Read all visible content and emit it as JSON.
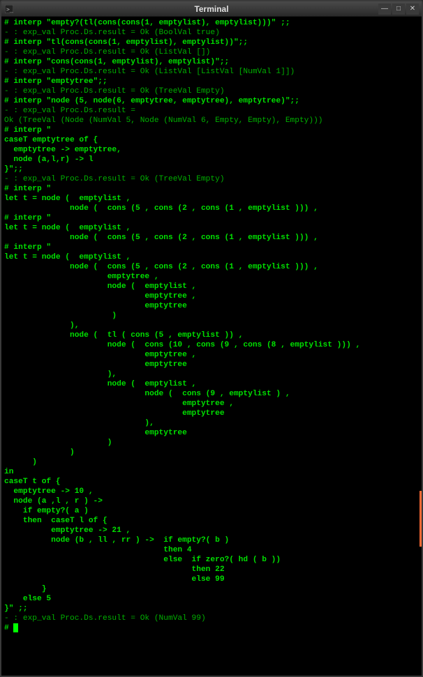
{
  "window": {
    "title": "Terminal"
  },
  "terminal": {
    "lines": [
      {
        "cls": "prompt",
        "text": "# interp \"empty?(tl(cons(cons(1, emptylist), emptylist)))\" ;;"
      },
      {
        "cls": "output",
        "text": "- : exp_val Proc.Ds.result = Ok (BoolVal true)"
      },
      {
        "cls": "prompt",
        "text": "# interp \"tl(cons(cons(1, emptylist), emptylist))\";;"
      },
      {
        "cls": "output",
        "text": "- : exp_val Proc.Ds.result = Ok (ListVal [])"
      },
      {
        "cls": "prompt",
        "text": "# interp \"cons(cons(1, emptylist), emptylist)\";;"
      },
      {
        "cls": "output",
        "text": "- : exp_val Proc.Ds.result = Ok (ListVal [ListVal [NumVal 1]])"
      },
      {
        "cls": "prompt",
        "text": "# interp \"emptytree\";;"
      },
      {
        "cls": "output",
        "text": "- : exp_val Proc.Ds.result = Ok (TreeVal Empty)"
      },
      {
        "cls": "prompt",
        "text": "# interp \"node (5, node(6, emptytree, emptytree), emptytree)\";;"
      },
      {
        "cls": "output",
        "text": "- : exp_val Proc.Ds.result ="
      },
      {
        "cls": "output",
        "text": "Ok (TreeVal (Node (NumVal 5, Node (NumVal 6, Empty, Empty), Empty)))"
      },
      {
        "cls": "prompt",
        "text": "# interp \""
      },
      {
        "cls": "prompt",
        "text": "caseT emptytree of {"
      },
      {
        "cls": "prompt",
        "text": "  emptytree -> emptytree,"
      },
      {
        "cls": "prompt",
        "text": "  node (a,l,r) -> l"
      },
      {
        "cls": "prompt",
        "text": "}\";;"
      },
      {
        "cls": "output",
        "text": "- : exp_val Proc.Ds.result = Ok (TreeVal Empty)"
      },
      {
        "cls": "prompt",
        "text": "# interp \""
      },
      {
        "cls": "prompt",
        "text": "let t = node (  emptylist ,"
      },
      {
        "cls": "prompt",
        "text": "              node (  cons (5 , cons (2 , cons (1 , emptylist ))) ,"
      },
      {
        "cls": "prompt",
        "text": "# interp \""
      },
      {
        "cls": "prompt",
        "text": "let t = node (  emptylist ,"
      },
      {
        "cls": "prompt",
        "text": "              node (  cons (5 , cons (2 , cons (1 , emptylist ))) ,"
      },
      {
        "cls": "prompt",
        "text": "# interp \""
      },
      {
        "cls": "prompt",
        "text": "let t = node (  emptylist ,"
      },
      {
        "cls": "prompt",
        "text": "              node (  cons (5 , cons (2 , cons (1 , emptylist ))) ,"
      },
      {
        "cls": "prompt",
        "text": "                      emptytree ,"
      },
      {
        "cls": "prompt",
        "text": "                      node (  emptylist ,"
      },
      {
        "cls": "prompt",
        "text": "                              emptytree ,"
      },
      {
        "cls": "prompt",
        "text": "                              emptytree"
      },
      {
        "cls": "prompt",
        "text": "                       )"
      },
      {
        "cls": "prompt",
        "text": "              ),"
      },
      {
        "cls": "prompt",
        "text": "              node (  tl ( cons (5 , emptylist )) ,"
      },
      {
        "cls": "prompt",
        "text": "                      node (  cons (10 , cons (9 , cons (8 , emptylist ))) ,"
      },
      {
        "cls": "prompt",
        "text": "                              emptytree ,"
      },
      {
        "cls": "prompt",
        "text": "                              emptytree"
      },
      {
        "cls": "prompt",
        "text": "                      ),"
      },
      {
        "cls": "prompt",
        "text": "                      node (  emptylist ,"
      },
      {
        "cls": "prompt",
        "text": "                              node (  cons (9 , emptylist ) ,"
      },
      {
        "cls": "prompt",
        "text": "                                      emptytree ,"
      },
      {
        "cls": "prompt",
        "text": "                                      emptytree"
      },
      {
        "cls": "prompt",
        "text": "                              ),"
      },
      {
        "cls": "prompt",
        "text": "                              emptytree"
      },
      {
        "cls": "prompt",
        "text": "                      )"
      },
      {
        "cls": "prompt",
        "text": "              )"
      },
      {
        "cls": "prompt",
        "text": "      )"
      },
      {
        "cls": "prompt",
        "text": "in"
      },
      {
        "cls": "prompt",
        "text": "caseT t of {"
      },
      {
        "cls": "prompt",
        "text": "  emptytree -> 10 ,"
      },
      {
        "cls": "prompt",
        "text": "  node (a ,l , r ) ->"
      },
      {
        "cls": "prompt",
        "text": "    if empty?( a )"
      },
      {
        "cls": "prompt",
        "text": "    then  caseT l of {"
      },
      {
        "cls": "prompt",
        "text": "          emptytree -> 21 ,"
      },
      {
        "cls": "prompt",
        "text": "          node (b , ll , rr ) ->  if empty?( b )"
      },
      {
        "cls": "prompt",
        "text": "                                  then 4"
      },
      {
        "cls": "prompt",
        "text": "                                  else  if zero?( hd ( b ))"
      },
      {
        "cls": "prompt",
        "text": "                                        then 22"
      },
      {
        "cls": "prompt",
        "text": "                                        else 99"
      },
      {
        "cls": "prompt",
        "text": "        }"
      },
      {
        "cls": "prompt",
        "text": "    else 5"
      },
      {
        "cls": "prompt",
        "text": "}\" ;;"
      },
      {
        "cls": "output",
        "text": "- : exp_val Proc.Ds.result = Ok (NumVal 99)"
      },
      {
        "cls": "prompt",
        "text": "# ",
        "cursor": true
      }
    ]
  }
}
